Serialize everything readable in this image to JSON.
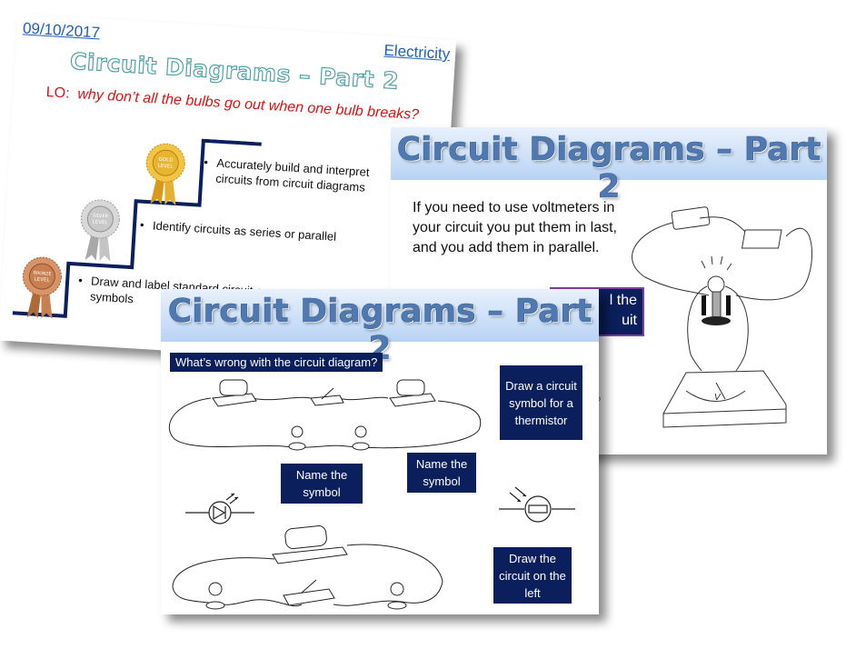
{
  "slide1": {
    "date": "09/10/2017",
    "topic": "Electricity",
    "title": "Circuit Diagrams – Part 2",
    "lo_prefix": "LO:",
    "lo_question": "why don’t all the bulbs go out when one bulb breaks?",
    "levels": [
      {
        "medal": "Gold Level",
        "objective_line1": "Accurately build and interpret",
        "objective_line2": "circuits from circuit diagrams"
      },
      {
        "medal": "Silver Level",
        "objective_line1": "Identify circuits as series or parallel"
      },
      {
        "medal": "Bronze Level",
        "objective_line1": "Draw and label standard circuit component",
        "objective_line2": "symbols"
      }
    ],
    "medal_labels": {
      "gold_a": "GOLD",
      "gold_b": "LEVEL",
      "silver_a": "SILVER",
      "silver_b": "LEVEL",
      "bronze_a": "BRONZE",
      "bronze_b": "LEVEL"
    },
    "colors": {
      "gold": "#e0a820",
      "silver": "#b8b8b8",
      "bronze": "#c07a48",
      "stairs": "#0b1f5c"
    }
  },
  "slide2": {
    "title": "Circuit Diagrams – Part 2",
    "body": "If you need to use voltmeters in your circuit you put them in last, and you add them in parallel.",
    "box_line1": "l the",
    "box_line2": "uit",
    "tiny_text": "p"
  },
  "slide3": {
    "title": "Circuit Diagrams – Part 2",
    "question": "What’s wrong with the circuit diagram?",
    "boxes": {
      "thermistor": "Draw a circuit symbol for a thermistor",
      "name_symbol_1": "Name the symbol",
      "name_symbol_2": "Name the symbol",
      "draw_circuit": "Draw the circuit on the left"
    }
  }
}
